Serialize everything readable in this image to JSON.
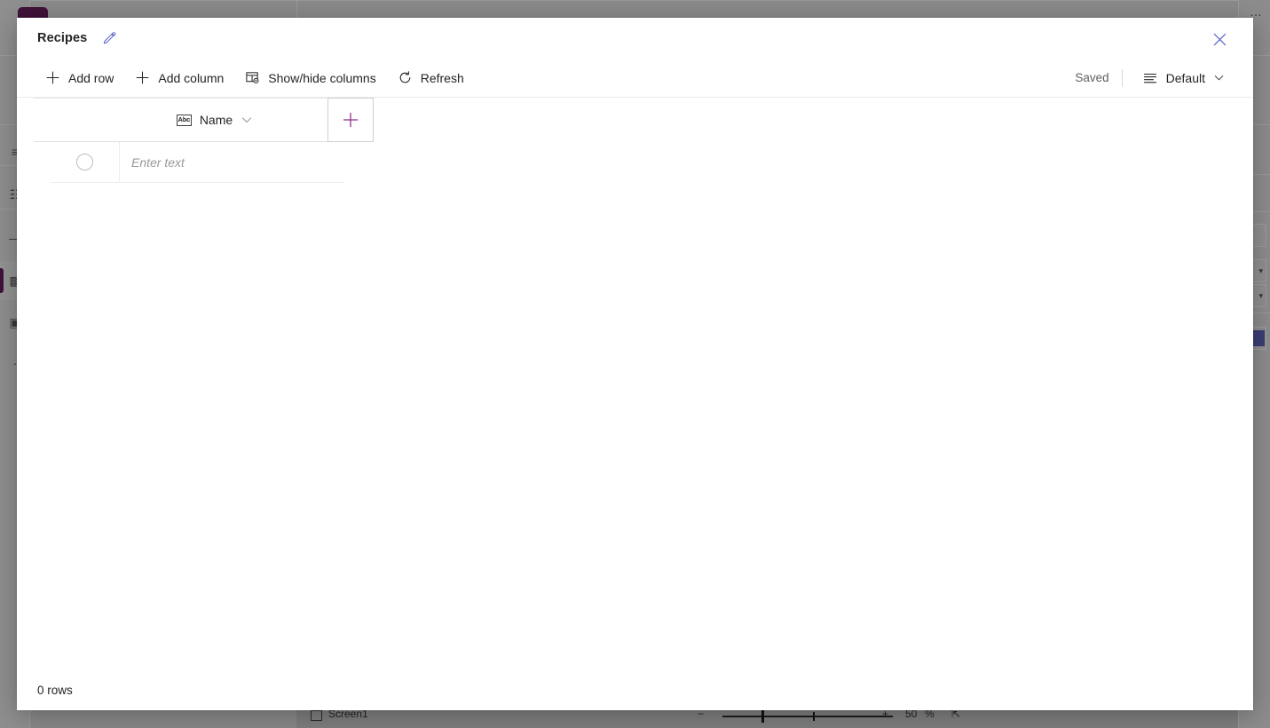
{
  "background": {
    "bottom_bar": {
      "screen_label": "Screen1",
      "zoom_value": "50",
      "zoom_unit": "%",
      "minus_label": "−",
      "plus_label": "+"
    },
    "brand_color": "#40123a",
    "rail_icons": [
      {
        "name": "tree-view-icon",
        "glyph": "≡"
      },
      {
        "name": "insert-icon",
        "glyph": "⠿"
      },
      {
        "name": "media-icon",
        "glyph": "—"
      },
      {
        "name": "data-icon",
        "glyph": "◧"
      },
      {
        "name": "variables-icon",
        "glyph": "☷"
      },
      {
        "name": "search-rail-icon",
        "glyph": "·"
      }
    ]
  },
  "modal": {
    "title": "Recipes",
    "edit_icon": "pencil-icon",
    "close_icon": "close-icon",
    "accent_color": "#5b5fc7",
    "plus_accent_color": "#8a2d8a",
    "toolbar": {
      "add_row": "Add row",
      "add_column": "Add column",
      "show_hide_columns": "Show/hide columns",
      "refresh": "Refresh",
      "saved_status": "Saved",
      "view_name": "Default"
    },
    "grid": {
      "columns": [
        {
          "label": "Name",
          "type_icon_text": "Abc",
          "type": "text"
        }
      ],
      "add_column_button_label": "+",
      "new_row": {
        "placeholder": "Enter text",
        "value": ""
      }
    },
    "footer": {
      "row_count_label": "0 rows"
    }
  }
}
